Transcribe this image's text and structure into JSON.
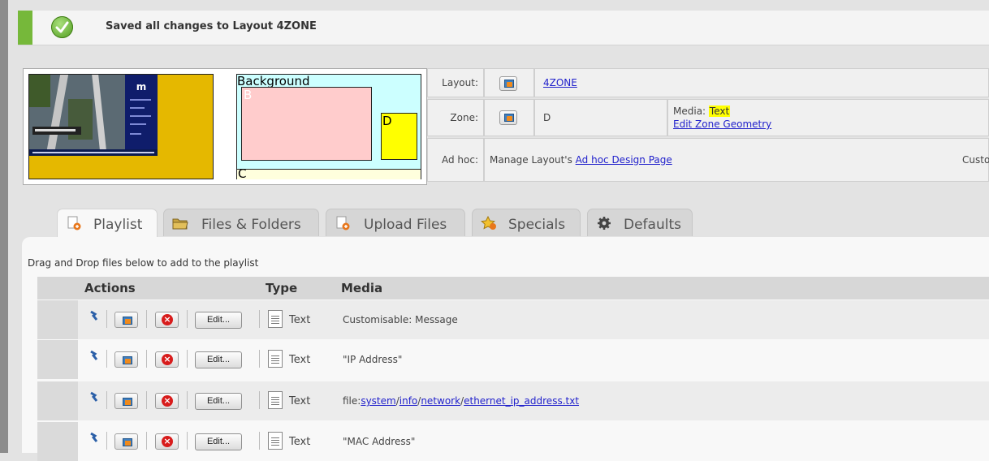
{
  "notification": {
    "message": "Saved all changes to Layout 4ZONE",
    "icon": "check-icon",
    "color": "#76b83a"
  },
  "preview": {
    "zone_labels": {
      "background": "Background",
      "b": "B",
      "c": "C",
      "d": "D"
    },
    "zone_colors": {
      "background": "#ccffff",
      "b": "#ffcccc",
      "c": "#ffffdd",
      "d": "#ffff00"
    },
    "thumbnail_logo": "m"
  },
  "props": {
    "layout_label": "Layout:",
    "layout_value": "4ZONE",
    "zone_label": "Zone:",
    "zone_value": "D",
    "media_label": "Media:",
    "media_value": "Text",
    "edit_geometry": "Edit Zone Geometry",
    "adhoc_label": "Ad hoc:",
    "adhoc_prefix": "Manage Layout's",
    "adhoc_link": "Ad hoc Design Page",
    "adhoc_right": "Custom"
  },
  "tabs": [
    {
      "label": "Playlist",
      "icon": "document-add-icon",
      "active": true
    },
    {
      "label": "Files & Folders",
      "icon": "folder-icon",
      "active": false
    },
    {
      "label": "Upload Files",
      "icon": "upload-file-icon",
      "active": false
    },
    {
      "label": "Specials",
      "icon": "star-icon",
      "active": false
    },
    {
      "label": "Defaults",
      "icon": "gear-icon",
      "active": false
    }
  ],
  "playlist": {
    "hint": "Drag and Drop files below to add to the playlist",
    "columns": {
      "actions": "Actions",
      "type": "Type",
      "media": "Media"
    },
    "edit_label": "Edit...",
    "rows": [
      {
        "type": "Text",
        "media": "Customisable: Message"
      },
      {
        "type": "Text",
        "media": "\"IP Address\""
      },
      {
        "type": "Text",
        "media_prefix": "file:",
        "path": [
          "system",
          "info",
          "network",
          "ethernet_ip_address.txt"
        ]
      },
      {
        "type": "Text",
        "media": "\"MAC Address\""
      }
    ]
  }
}
